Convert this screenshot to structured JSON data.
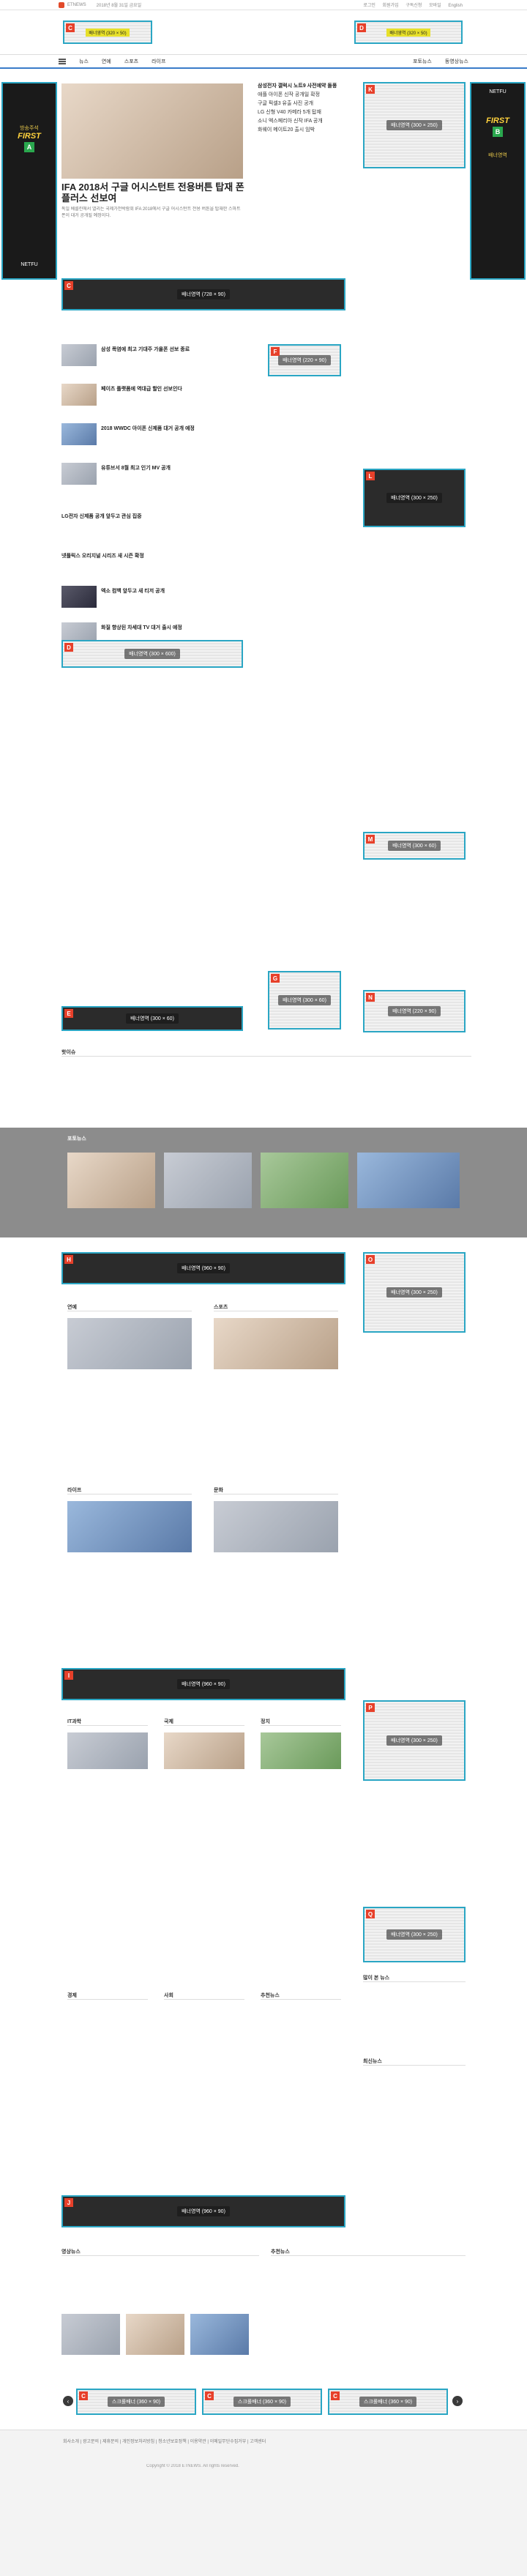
{
  "topbar": {
    "site": "ETNEWS",
    "date": "2018년 8월 31일 금요일",
    "links": [
      "로그인",
      "회원가입",
      "구독신청",
      "모바일",
      "English"
    ]
  },
  "nav": {
    "items": [
      "뉴스",
      "연예",
      "스포츠",
      "라이프"
    ],
    "right_items": [
      "포토뉴스",
      "동영상뉴스"
    ]
  },
  "ads": {
    "A": {
      "label": "A",
      "text": "배너영역 (160 × 600)"
    },
    "B": {
      "label": "B",
      "text": "배너영역 (160 × 600)"
    },
    "C": {
      "label": "C",
      "text": "배너영역 (728 × 90)"
    },
    "D": {
      "label": "D",
      "text": "배너영역 (300 × 600)"
    },
    "E": {
      "label": "E",
      "text": "배너영역 (300 × 60)"
    },
    "F": {
      "label": "F",
      "text": "배너영역 (220 × 90)"
    },
    "G": {
      "label": "G",
      "text": "배너영역 (300 × 60)"
    },
    "H": {
      "label": "H",
      "text": "배너영역 (960 × 90)"
    },
    "I": {
      "label": "I",
      "text": "배너영역 (960 × 90)"
    },
    "J": {
      "label": "J",
      "text": "배너영역 (960 × 90)"
    },
    "K": {
      "label": "K",
      "text": "배너영역 (300 × 250)"
    },
    "L": {
      "label": "L",
      "text": "배너영역 (300 × 250)"
    },
    "M": {
      "label": "M",
      "text": "배너영역 (300 × 60)"
    },
    "N": {
      "label": "N",
      "text": "배너영역 (220 × 90)"
    },
    "O": {
      "label": "O",
      "text": "배너영역 (300 × 250)"
    },
    "P": {
      "label": "P",
      "text": "배너영역 (300 × 250)"
    },
    "Q": {
      "label": "Q",
      "text": "배너영역 (300 × 250)"
    },
    "top_left": {
      "label": "C",
      "text": "배너영역 (320 × 50)"
    },
    "top_right": {
      "label": "D",
      "text": "배너영역 (320 × 50)"
    },
    "footer_1": {
      "label": "C",
      "text": "스크롤배너 (360 × 90)"
    },
    "footer_2": {
      "label": "C",
      "text": "스크롤배너 (360 × 90)"
    },
    "footer_3": {
      "label": "C",
      "text": "스크롤배너 (360 × 90)"
    }
  },
  "side_ads": {
    "left": {
      "top": "방송주석",
      "brand": "FIRST",
      "letter": "A",
      "bottom": "NETFU"
    },
    "right": {
      "top": "NETFU",
      "brand": "FIRST",
      "letter": "B",
      "bottom": "배너영역"
    }
  },
  "headline": {
    "title": "IFA 2018서 구글 어시스턴트 전용버튼 탑재 폰 플러스 선보여",
    "summary": "독일 베를린에서 열리는 국제가전박람회 IFA 2018에서 구글 어시스턴트 전용 버튼을 탑재한 스마트폰이 대거 공개될 예정이다."
  },
  "main_list": [
    "삼성 폭염에 최고 기대주 가을폰 선보 종료",
    "페이츠 플랫폼에 역대급 할인 선보인다",
    "2018 WWDC 아이폰 신제품 대거 공개 예정",
    "유튜브서 8월 최고 인기 MV 공개",
    "LG전자 신제품 공개 앞두고 관심 집중",
    "넷플릭스 오리지널 시리즈 새 시즌 확정",
    "엑소 컴백 앞두고 새 티저 공개",
    "화질 향상된 차세대 TV 대거 출시 예정"
  ],
  "right_list": [
    "삼성전자 갤럭시 노트9 사전예약 돌풍",
    "애플 아이폰 신작 공개일 확정",
    "구글 픽셀3 유출 사진 공개",
    "LG 신형 V40 카메라 5개 탑재",
    "소니 엑스페리아 신작 IFA 공개",
    "화웨이 메이트20 출시 임박"
  ],
  "sections": {
    "hot_issue": "핫이슈",
    "photo": "포토뉴스",
    "ent": "연예",
    "sports": "스포츠",
    "life": "라이프",
    "culture": "문화",
    "it": "IT과학",
    "world": "국제",
    "politics": "정치",
    "economy": "경제",
    "society": "사회",
    "popular": "많이 본 뉴스",
    "latest": "최신뉴스",
    "recommend": "추천뉴스",
    "video": "영상뉴스"
  },
  "more": "더보기 +",
  "footer": {
    "links": [
      "회사소개",
      "광고문의",
      "제휴문의",
      "개인정보처리방침",
      "청소년보호정책",
      "이용약관",
      "이메일무단수집거부",
      "고객센터"
    ],
    "copyright": "Copyright © 2018 ETNEWS. All rights reserved."
  },
  "colors": {
    "accent": "#3a7bc8",
    "ad_border": "#2aa6c4",
    "ad_label": "#e7402a"
  }
}
